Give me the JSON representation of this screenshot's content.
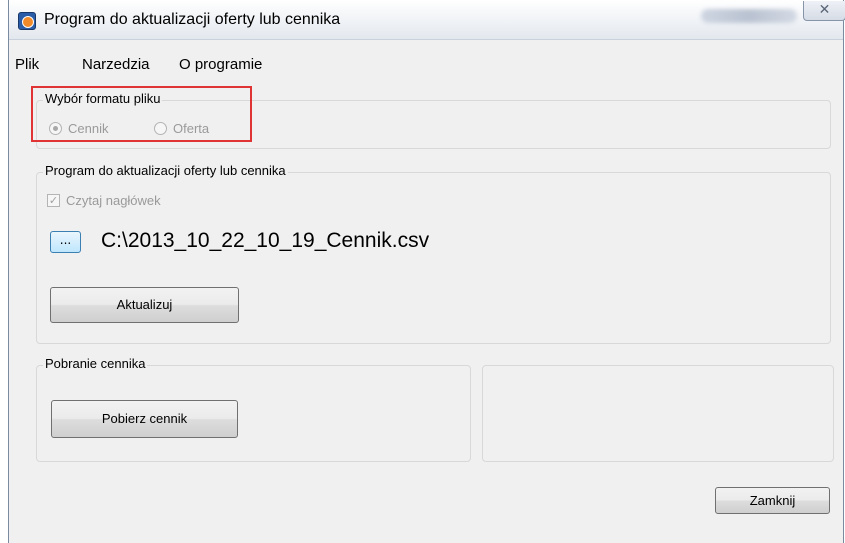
{
  "window": {
    "title": "Program do aktualizacji oferty lub cennika",
    "close_symbol": "✕"
  },
  "menu": {
    "items": [
      "Plik",
      "Narzedzia",
      "O programie"
    ]
  },
  "format_group": {
    "title": "Wybór formatu pliku",
    "options": [
      {
        "label": "Cennik",
        "checked": true
      },
      {
        "label": "Oferta",
        "checked": false
      }
    ]
  },
  "update_group": {
    "title": "Program do aktualizacji oferty lub cennika",
    "checkbox_label": "Czytaj nagłówek",
    "checkbox_checked": true,
    "browse_label": "...",
    "file_path": "C:\\2013_10_22_10_19_Cennik.csv",
    "update_button": "Aktualizuj"
  },
  "download_group": {
    "title": "Pobranie cennika",
    "download_button": "Pobierz cennik"
  },
  "footer": {
    "close_button": "Zamknij"
  },
  "colors": {
    "highlight_border": "#e03434",
    "window_bg": "#f0f0f0"
  },
  "icons": {
    "app": "app-icon",
    "close": "close-icon"
  }
}
